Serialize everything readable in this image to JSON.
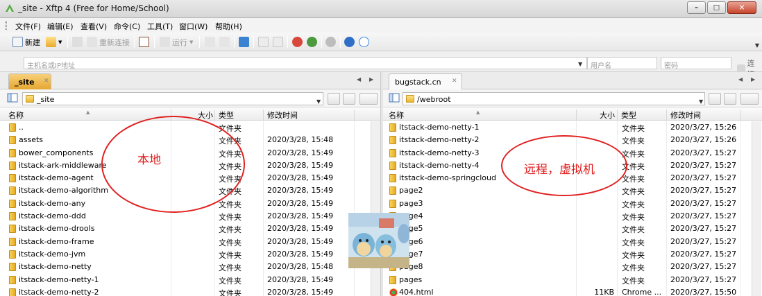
{
  "window": {
    "title": "_site - Xftp 4 (Free for Home/School)",
    "buttons": [
      "minimize",
      "maximize",
      "close"
    ]
  },
  "menu": [
    "文件(F)",
    "编辑(E)",
    "查看(V)",
    "命令(C)",
    "工具(T)",
    "窗口(W)",
    "帮助(H)"
  ],
  "toolbar": {
    "new_label": "新建",
    "reconnect_label": "重新连接",
    "run_label": "运行"
  },
  "address": {
    "host_placeholder": "主机名或IP地址",
    "user_placeholder": "用户名",
    "password_placeholder": "密码",
    "connect_label": "连接"
  },
  "left": {
    "tab": "_site",
    "path": "_site",
    "columns": {
      "name": "名称",
      "size": "大小",
      "type": "类型",
      "modified": "修改时间"
    },
    "annotation": "本地",
    "rows": [
      {
        "name": "..",
        "size": "",
        "type": "文件夹",
        "modified": ""
      },
      {
        "name": "assets",
        "size": "",
        "type": "文件夹",
        "modified": "2020/3/28, 15:48"
      },
      {
        "name": "bower_components",
        "size": "",
        "type": "文件夹",
        "modified": "2020/3/28, 15:49"
      },
      {
        "name": "itstack-ark-middleware",
        "size": "",
        "type": "文件夹",
        "modified": "2020/3/28, 15:49"
      },
      {
        "name": "itstack-demo-agent",
        "size": "",
        "type": "文件夹",
        "modified": "2020/3/28, 15:49"
      },
      {
        "name": "itstack-demo-algorithm",
        "size": "",
        "type": "文件夹",
        "modified": "2020/3/28, 15:49"
      },
      {
        "name": "itstack-demo-any",
        "size": "",
        "type": "文件夹",
        "modified": "2020/3/28, 15:49"
      },
      {
        "name": "itstack-demo-ddd",
        "size": "",
        "type": "文件夹",
        "modified": "2020/3/28, 15:49"
      },
      {
        "name": "itstack-demo-drools",
        "size": "",
        "type": "文件夹",
        "modified": "2020/3/28, 15:49"
      },
      {
        "name": "itstack-demo-frame",
        "size": "",
        "type": "文件夹",
        "modified": "2020/3/28, 15:49"
      },
      {
        "name": "itstack-demo-jvm",
        "size": "",
        "type": "文件夹",
        "modified": "2020/3/28, 15:49"
      },
      {
        "name": "itstack-demo-netty",
        "size": "",
        "type": "文件夹",
        "modified": "2020/3/28, 15:48"
      },
      {
        "name": "itstack-demo-netty-1",
        "size": "",
        "type": "文件夹",
        "modified": "2020/3/28, 15:49"
      },
      {
        "name": "itstack-demo-netty-2",
        "size": "",
        "type": "文件夹",
        "modified": "2020/3/28, 15:49"
      }
    ]
  },
  "right": {
    "tab": "bugstack.cn",
    "path": "/webroot",
    "columns": {
      "name": "名称",
      "size": "大小",
      "type": "类型",
      "modified": "修改时间"
    },
    "annotation": "远程，虚拟机",
    "rows": [
      {
        "name": "itstack-demo-netty-1",
        "size": "",
        "type": "文件夹",
        "modified": "2020/3/27, 15:26"
      },
      {
        "name": "itstack-demo-netty-2",
        "size": "",
        "type": "文件夹",
        "modified": "2020/3/27, 15:26"
      },
      {
        "name": "itstack-demo-netty-3",
        "size": "",
        "type": "文件夹",
        "modified": "2020/3/27, 15:27"
      },
      {
        "name": "itstack-demo-netty-4",
        "size": "",
        "type": "文件夹",
        "modified": "2020/3/27, 15:27"
      },
      {
        "name": "itstack-demo-springcloud",
        "size": "",
        "type": "文件夹",
        "modified": "2020/3/27, 15:27"
      },
      {
        "name": "page2",
        "size": "",
        "type": "文件夹",
        "modified": "2020/3/27, 15:27"
      },
      {
        "name": "page3",
        "size": "",
        "type": "文件夹",
        "modified": "2020/3/27, 15:27"
      },
      {
        "name": "page4",
        "size": "",
        "type": "文件夹",
        "modified": "2020/3/27, 15:27"
      },
      {
        "name": "page5",
        "size": "",
        "type": "文件夹",
        "modified": "2020/3/27, 15:27"
      },
      {
        "name": "page6",
        "size": "",
        "type": "文件夹",
        "modified": "2020/3/27, 15:27"
      },
      {
        "name": "page7",
        "size": "",
        "type": "文件夹",
        "modified": "2020/3/27, 15:27"
      },
      {
        "name": "page8",
        "size": "",
        "type": "文件夹",
        "modified": "2020/3/27, 15:27"
      },
      {
        "name": "pages",
        "size": "",
        "type": "文件夹",
        "modified": "2020/3/27, 15:27"
      },
      {
        "name": "404.html",
        "size": "11KB",
        "type": "Chrome ...",
        "modified": "2020/3/27, 15:50"
      }
    ]
  }
}
